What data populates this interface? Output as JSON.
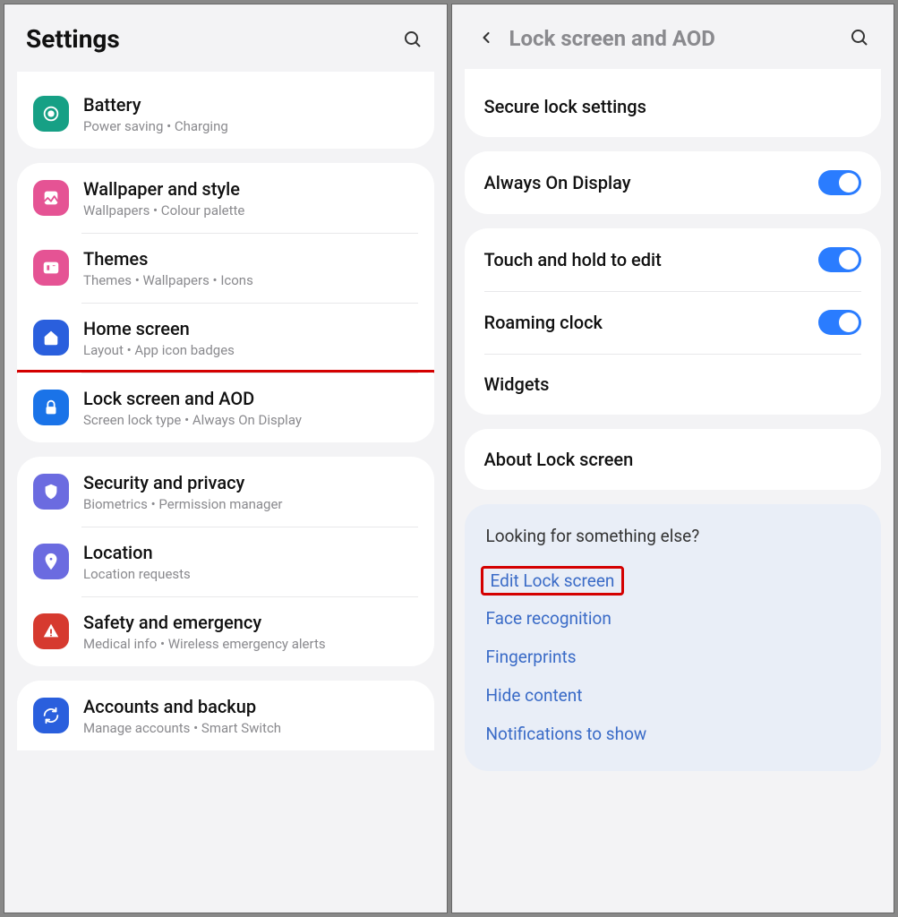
{
  "left": {
    "title": "Settings",
    "groups": [
      {
        "partial_top": true,
        "items": [
          {
            "id": "battery",
            "icon": "battery",
            "icon_bg": "#16a085",
            "title": "Battery",
            "sub": "Power saving  •  Charging"
          }
        ]
      },
      {
        "items": [
          {
            "id": "wallpaper",
            "icon": "wallpaper",
            "icon_bg": "#e55394",
            "title": "Wallpaper and style",
            "sub": "Wallpapers  •  Colour palette"
          },
          {
            "id": "themes",
            "icon": "themes",
            "icon_bg": "#e55394",
            "title": "Themes",
            "sub": "Themes  •  Wallpapers  •  Icons"
          },
          {
            "id": "home",
            "icon": "home",
            "icon_bg": "#2a5fdd",
            "title": "Home screen",
            "sub": "Layout  •  App icon badges"
          },
          {
            "id": "lockscreen",
            "icon": "lock",
            "icon_bg": "#1a73e8",
            "title": "Lock screen and AOD",
            "sub": "Screen lock type  •  Always On Display",
            "highlight": true
          }
        ]
      },
      {
        "items": [
          {
            "id": "security",
            "icon": "shield",
            "icon_bg": "#6b6be0",
            "title": "Security and privacy",
            "sub": "Biometrics  •  Permission manager"
          },
          {
            "id": "location",
            "icon": "location",
            "icon_bg": "#6b6be0",
            "title": "Location",
            "sub": "Location requests"
          },
          {
            "id": "safety",
            "icon": "alert",
            "icon_bg": "#d63a2f",
            "title": "Safety and emergency",
            "sub": "Medical info  •  Wireless emergency alerts"
          }
        ]
      },
      {
        "partial_bottom": true,
        "items": [
          {
            "id": "accounts",
            "icon": "sync",
            "icon_bg": "#2a5fdd",
            "title": "Accounts and backup",
            "sub": "Manage accounts  •  Smart Switch"
          }
        ]
      }
    ]
  },
  "right": {
    "title": "Lock screen and AOD",
    "groups": [
      {
        "partial_top": true,
        "items": [
          {
            "id": "securelock",
            "title": "Secure lock settings"
          }
        ]
      },
      {
        "items": [
          {
            "id": "aod",
            "title": "Always On Display",
            "toggle": true
          }
        ]
      },
      {
        "items": [
          {
            "id": "touchhold",
            "title": "Touch and hold to edit",
            "toggle": true
          },
          {
            "id": "roaming",
            "title": "Roaming clock",
            "toggle": true
          },
          {
            "id": "widgets",
            "title": "Widgets"
          }
        ]
      },
      {
        "items": [
          {
            "id": "about",
            "title": "About Lock screen"
          }
        ]
      }
    ],
    "looking": {
      "heading": "Looking for something else?",
      "links": [
        {
          "id": "edit-lock",
          "label": "Edit Lock screen",
          "highlight": true
        },
        {
          "id": "face",
          "label": "Face recognition"
        },
        {
          "id": "finger",
          "label": "Fingerprints"
        },
        {
          "id": "hide",
          "label": "Hide content"
        },
        {
          "id": "notif",
          "label": "Notifications to show"
        }
      ]
    }
  }
}
